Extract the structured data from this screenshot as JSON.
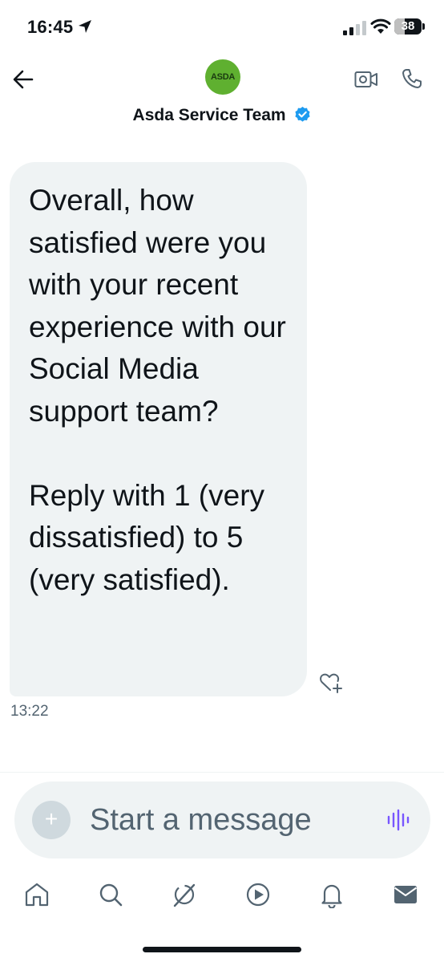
{
  "status_bar": {
    "time": "16:45",
    "battery_level": "38",
    "location_icon": "location-arrow-icon",
    "signal_icon": "cellular-signal-icon",
    "wifi_icon": "wifi-icon"
  },
  "header": {
    "contact_name": "Asda Service Team",
    "avatar_text": "ASDA",
    "verified_icon": "verified-badge-icon",
    "back_icon": "back-arrow-icon",
    "video_icon": "video-call-icon",
    "call_icon": "phone-call-icon"
  },
  "conversation": {
    "messages": [
      {
        "text": "Overall, how satisfied were you with your recent experience with our Social Media support team?\n\nReply with 1 (very dissatisfied) to 5 (very satisfied).",
        "time": "13:22",
        "reaction_icon": "add-reaction-heart-icon"
      }
    ]
  },
  "composer": {
    "placeholder": "Start a message",
    "add_icon": "plus-icon",
    "voice_icon": "voice-waveform-icon"
  },
  "tabs": [
    {
      "name": "home",
      "icon": "home-icon"
    },
    {
      "name": "search",
      "icon": "search-icon"
    },
    {
      "name": "grok",
      "icon": "grok-icon"
    },
    {
      "name": "video",
      "icon": "play-icon"
    },
    {
      "name": "notifications",
      "icon": "bell-icon"
    },
    {
      "name": "messages",
      "icon": "envelope-icon",
      "active": true
    }
  ],
  "colors": {
    "verified_blue": "#1d9bf0",
    "bubble_bg": "#eff3f4",
    "brand_green": "#5fb030",
    "voice_purple": "#7856ff",
    "muted_text": "#536471"
  }
}
